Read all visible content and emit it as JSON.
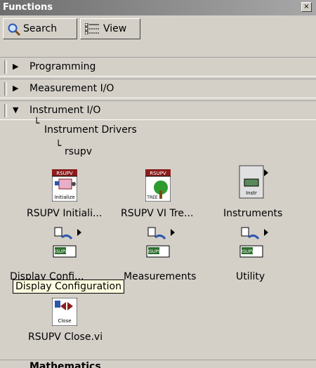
{
  "window": {
    "title": "Functions",
    "close_glyph": "×"
  },
  "toolbar": {
    "search_label": "Search",
    "view_label": "View"
  },
  "tree": {
    "programming": "Programming",
    "measurement_io": "Measurement I/O",
    "instrument_io": "Instrument I/O",
    "instrument_drivers": "Instrument Drivers",
    "rsupv": "rsupv",
    "collapsed_arrow": "▶",
    "expanded_arrow": "▼"
  },
  "palette": {
    "items": [
      {
        "label": "RSUPV Initiali...",
        "icon": "rsupv-initialize-icon",
        "icon_text_top": "RSUPV",
        "icon_text_bottom": "Initialize"
      },
      {
        "label": "RSUPV VI Tre...",
        "icon": "rsupv-vi-tree-icon",
        "icon_text_top": "RSUPV",
        "icon_text_bottom": "TREE"
      },
      {
        "label": "Instruments",
        "icon": "instruments-folder-icon",
        "icon_text_bottom": "Instr"
      },
      {
        "label": "Display Confi...",
        "icon": "display-config-folder-icon",
        "icon_text_bottom": "RSUPV"
      },
      {
        "label": "Measurements",
        "icon": "measurements-folder-icon",
        "icon_text_bottom": "RSUPV"
      },
      {
        "label": "Utility",
        "icon": "utility-folder-icon",
        "icon_text_bottom": "RSUPV"
      },
      {
        "label": "RSUPV Close.vi",
        "icon": "rsupv-close-icon",
        "icon_text_bottom": "Close"
      }
    ]
  },
  "tooltip": "Display Configuration",
  "bottom_partial": "Mathematics"
}
